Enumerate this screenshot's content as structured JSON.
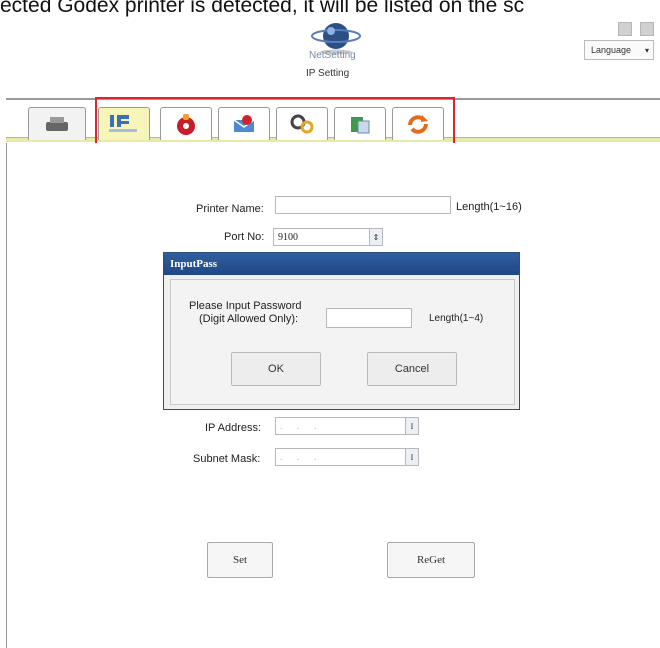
{
  "caption": "ected Godex printer is detected, it will be listed on the sc",
  "header": {
    "logo_text": "NetSetting",
    "title": "IP Setting",
    "language": "Language"
  },
  "tabs": [
    {
      "name": "printer",
      "icon": "printer-icon"
    },
    {
      "name": "ip",
      "icon": "ip-network-icon",
      "label": "IP"
    },
    {
      "name": "alarm",
      "icon": "alarm-bell-icon"
    },
    {
      "name": "mail",
      "icon": "mail-alert-icon"
    },
    {
      "name": "settings",
      "icon": "gears-icon"
    },
    {
      "name": "transfer",
      "icon": "file-transfer-icon"
    },
    {
      "name": "refresh",
      "icon": "refresh-icon"
    }
  ],
  "form": {
    "printer_name_label": "Printer Name:",
    "printer_name_value": "",
    "printer_name_hint": "Length(1~16)",
    "port_label": "Port No:",
    "port_value": "9100",
    "ip_label": "IP Address:",
    "subnet_label": "Subnet Mask:",
    "ip_placeholder": ".   .   .",
    "set_label": "Set",
    "reget_label": "ReGet"
  },
  "dialog": {
    "title": "InputPass",
    "prompt_line1": "Please Input Password",
    "prompt_line2": "(Digit Allowed Only):",
    "hint": "Length(1~4)",
    "ok_label": "OK",
    "cancel_label": "Cancel",
    "password_value": ""
  }
}
